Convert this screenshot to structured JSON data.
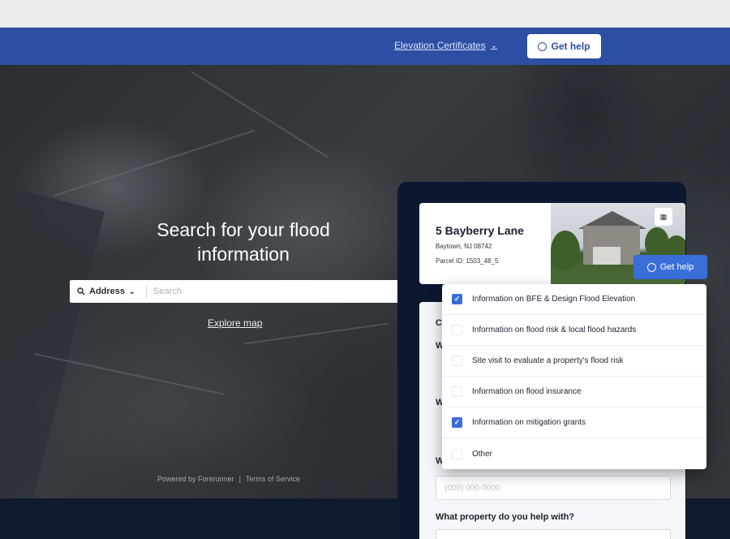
{
  "nav": {
    "dropdown_label": "Elevation Certificates",
    "help_label": "Get help"
  },
  "hero": {
    "title_line1": "Search for your flood",
    "title_line2": "information"
  },
  "search": {
    "type_label": "Address",
    "placeholder": "Search"
  },
  "explore_label": "Explore map",
  "footer": {
    "powered": "Powered by Forerunner",
    "separator": "|",
    "terms": "Terms of Service"
  },
  "property": {
    "name": "5 Bayberry Lane",
    "city": "Baytown, NJ 08742",
    "parcel": "Parcel ID: 1503_48_5"
  },
  "help_button_2": "Get help",
  "help_menu": {
    "items": [
      {
        "label": "Information on BFE & Design Flood Elevation",
        "checked": true
      },
      {
        "label": "Information on flood risk & local flood hazards",
        "checked": false
      },
      {
        "label": "Site visit to evaluate a property's flood risk",
        "checked": false
      },
      {
        "label": "Information on flood insurance",
        "checked": false
      },
      {
        "label": "Information on mitigation grants",
        "checked": true
      },
      {
        "label": "Other",
        "checked": false
      }
    ]
  },
  "form": {
    "partial_labels": [
      "C",
      "W",
      "W",
      "W"
    ],
    "phone_placeholder": "(000) 000-0000",
    "property_question": "What property do you help with?"
  },
  "colors": {
    "nav_blue": "#2c4ea3",
    "accent_blue": "#3a6ed8",
    "panel_navy": "#0c1830"
  }
}
